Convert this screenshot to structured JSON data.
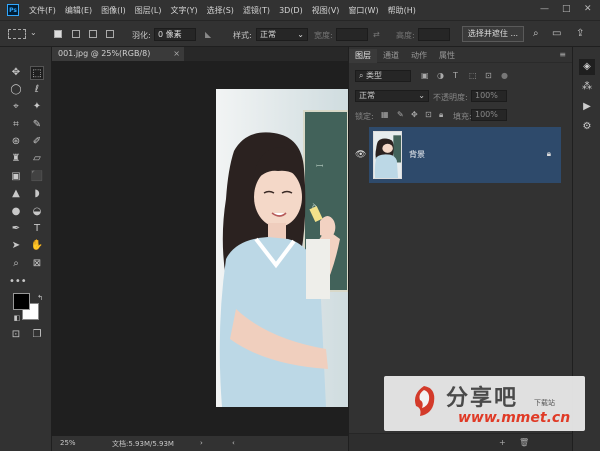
{
  "app": {
    "logo": "Ps"
  },
  "menu": [
    "文件(F)",
    "编辑(E)",
    "图像(I)",
    "图层(L)",
    "文字(Y)",
    "选择(S)",
    "滤镜(T)",
    "3D(D)",
    "视图(V)",
    "窗口(W)",
    "帮助(H)"
  ],
  "window_controls": {
    "minimize": "—",
    "maximize": "□",
    "close": "✕"
  },
  "options_bar": {
    "feather_label": "羽化:",
    "feather_value": "0 像素",
    "style_label": "样式:",
    "style_value": "正常",
    "width_label": "宽度:",
    "height_label": "高度:",
    "select_mask_button": "选择并遮住 ..."
  },
  "document": {
    "tab_title": "001.jpg @ 25%(RGB/8)",
    "tab_close": "×",
    "zoom": "25%",
    "doc_info": "文档:5.93M/5.93M"
  },
  "layers_panel": {
    "tabs": [
      "图层",
      "通道",
      "动作",
      "属性"
    ],
    "active_tab": 0,
    "filter_kind": "类型",
    "blend_mode": "正常",
    "opacity_label": "不透明度:",
    "opacity_value": "100%",
    "lock_label": "锁定:",
    "fill_label": "填充:",
    "fill_value": "100%",
    "layers": [
      {
        "name": "背景",
        "visible": true,
        "locked": true
      }
    ]
  },
  "watermark": {
    "brand": "分享吧",
    "sub": "下载站",
    "url": "www.mmet.cn"
  },
  "colors": {
    "ui_dark": "#323232",
    "canvas_bg": "#1f1f1f",
    "layer_selected": "#2e4a6b",
    "watermark_red": "#e03a26"
  }
}
